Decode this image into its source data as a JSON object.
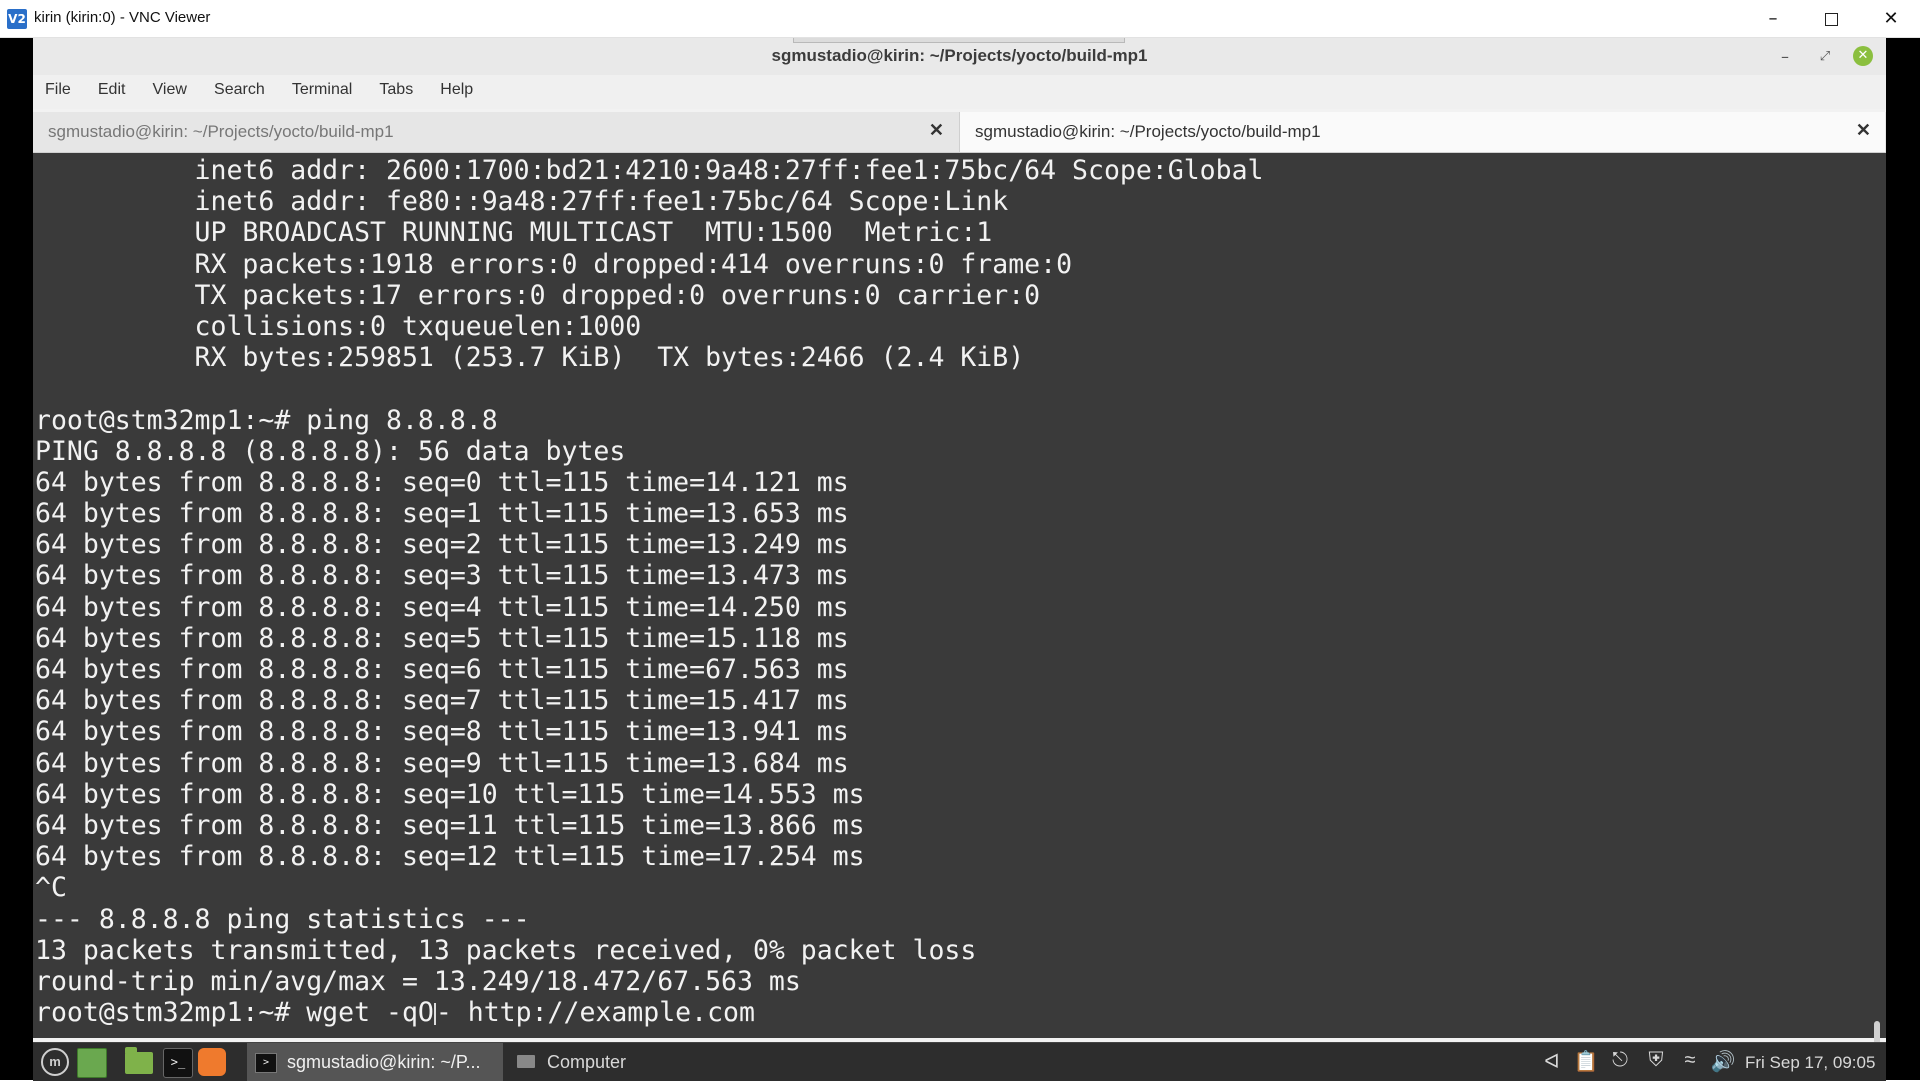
{
  "vnc": {
    "title": "kirin (kirin:0) - VNC Viewer",
    "logo_text": "V2"
  },
  "window": {
    "title": "sgmustadio@kirin: ~/Projects/yocto/build-mp1"
  },
  "menu": [
    "File",
    "Edit",
    "View",
    "Search",
    "Terminal",
    "Tabs",
    "Help"
  ],
  "tabs": [
    {
      "label": "sgmustadio@kirin: ~/Projects/yocto/build-mp1",
      "active": false
    },
    {
      "label": "sgmustadio@kirin: ~/Projects/yocto/build-mp1",
      "active": true
    }
  ],
  "terminal": {
    "lines": [
      "          inet6 addr: 2600:1700:bd21:4210:9a48:27ff:fee1:75bc/64 Scope:Global",
      "          inet6 addr: fe80::9a48:27ff:fee1:75bc/64 Scope:Link",
      "          UP BROADCAST RUNNING MULTICAST  MTU:1500  Metric:1",
      "          RX packets:1918 errors:0 dropped:414 overruns:0 frame:0",
      "          TX packets:17 errors:0 dropped:0 overruns:0 carrier:0",
      "          collisions:0 txqueuelen:1000",
      "          RX bytes:259851 (253.7 KiB)  TX bytes:2466 (2.4 KiB)",
      "",
      "root@stm32mp1:~# ping 8.8.8.8",
      "PING 8.8.8.8 (8.8.8.8): 56 data bytes",
      "64 bytes from 8.8.8.8: seq=0 ttl=115 time=14.121 ms",
      "64 bytes from 8.8.8.8: seq=1 ttl=115 time=13.653 ms",
      "64 bytes from 8.8.8.8: seq=2 ttl=115 time=13.249 ms",
      "64 bytes from 8.8.8.8: seq=3 ttl=115 time=13.473 ms",
      "64 bytes from 8.8.8.8: seq=4 ttl=115 time=14.250 ms",
      "64 bytes from 8.8.8.8: seq=5 ttl=115 time=15.118 ms",
      "64 bytes from 8.8.8.8: seq=6 ttl=115 time=67.563 ms",
      "64 bytes from 8.8.8.8: seq=7 ttl=115 time=15.417 ms",
      "64 bytes from 8.8.8.8: seq=8 ttl=115 time=13.941 ms",
      "64 bytes from 8.8.8.8: seq=9 ttl=115 time=13.684 ms",
      "64 bytes from 8.8.8.8: seq=10 ttl=115 time=14.553 ms",
      "64 bytes from 8.8.8.8: seq=11 ttl=115 time=13.866 ms",
      "64 bytes from 8.8.8.8: seq=12 ttl=115 time=17.254 ms",
      "^C",
      "--- 8.8.8.8 ping statistics ---",
      "13 packets transmitted, 13 packets received, 0% packet loss",
      "round-trip min/avg/max = 13.249/18.472/67.563 ms"
    ],
    "prompt_line_before_cursor": "root@stm32mp1:~# wget -qO",
    "prompt_line_after_cursor": "- http://example.com"
  },
  "panel": {
    "task_terminal_label": "sgmustadio@kirin: ~/P...",
    "task_computer_label": "Computer",
    "clock": "Fri Sep 17, 09:05",
    "launcher_icons": [
      "menu-icon",
      "show-desktop-icon",
      "files-icon",
      "terminal-icon",
      "firefox-icon"
    ],
    "tray_icons": [
      "bluetooth-icon",
      "clipboard-icon",
      "update-manager-icon",
      "shield-icon",
      "wifi-icon",
      "volume-icon"
    ]
  }
}
